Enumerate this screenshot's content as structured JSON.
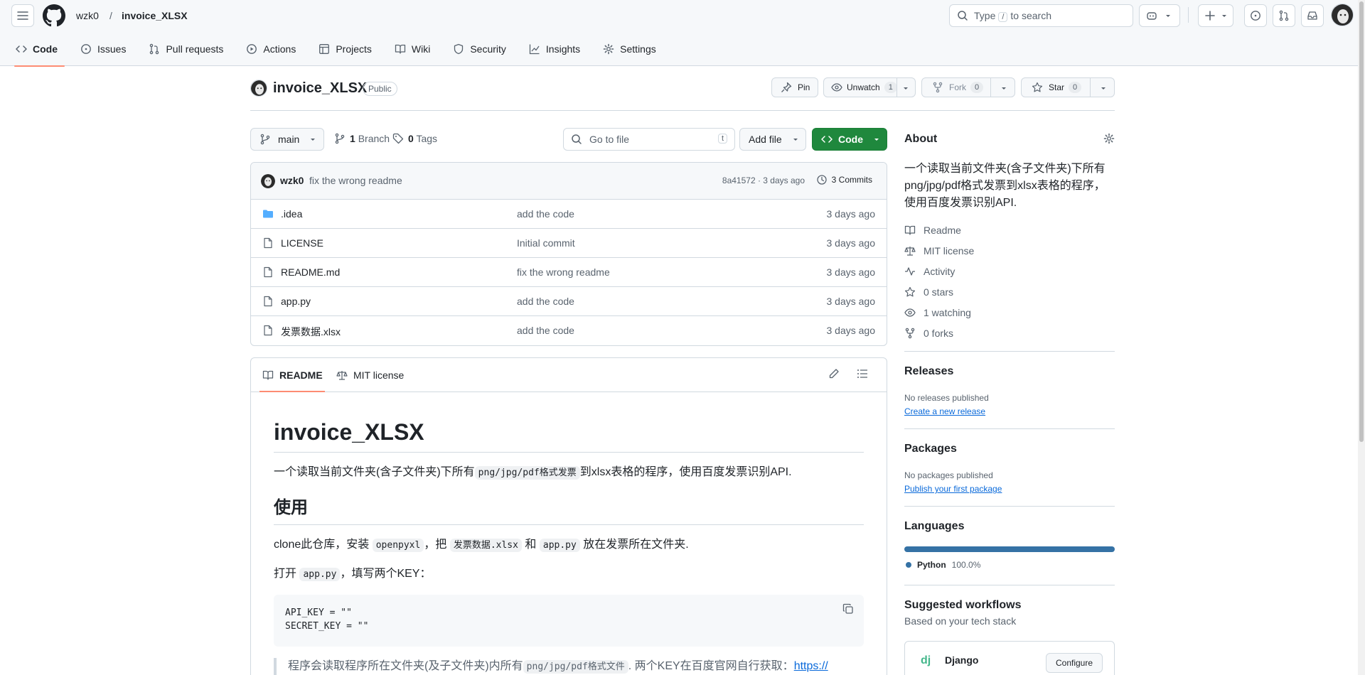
{
  "header": {
    "owner": "wzk0",
    "separator": "/",
    "repo": "invoice_XLSX",
    "search_pre": "Type",
    "search_key": "/",
    "search_post": "to search"
  },
  "tabs": [
    {
      "label": "Code",
      "icon": "code-icon"
    },
    {
      "label": "Issues",
      "icon": "issue-opened-icon"
    },
    {
      "label": "Pull requests",
      "icon": "git-pull-request-icon"
    },
    {
      "label": "Actions",
      "icon": "play-icon"
    },
    {
      "label": "Projects",
      "icon": "table-icon"
    },
    {
      "label": "Wiki",
      "icon": "book-icon"
    },
    {
      "label": "Security",
      "icon": "shield-icon"
    },
    {
      "label": "Insights",
      "icon": "graph-icon"
    },
    {
      "label": "Settings",
      "icon": "gear-icon"
    }
  ],
  "repo": {
    "name": "invoice_XLSX",
    "visibility": "Public",
    "pin": "Pin",
    "unwatch": "Unwatch",
    "watch_count": "1",
    "fork": "Fork",
    "fork_count": "0",
    "star": "Star",
    "star_count": "0"
  },
  "toolbar": {
    "branch": "main",
    "branch_count": "1",
    "branch_label": "Branch",
    "tag_count": "0",
    "tag_label": "Tags",
    "goto_placeholder": "Go to file",
    "goto_key": "t",
    "add_file": "Add file",
    "code": "Code"
  },
  "commit": {
    "author": "wzk0",
    "message": "fix the wrong readme",
    "hash_date": "8a41572 · 3 days ago",
    "commits": "3 Commits"
  },
  "files": [
    {
      "name": ".idea",
      "type": "folder",
      "commit": "add the code",
      "date": "3 days ago"
    },
    {
      "name": "LICENSE",
      "type": "file",
      "commit": "Initial commit",
      "date": "3 days ago"
    },
    {
      "name": "README.md",
      "type": "file",
      "commit": "fix the wrong readme",
      "date": "3 days ago"
    },
    {
      "name": "app.py",
      "type": "file",
      "commit": "add the code",
      "date": "3 days ago"
    },
    {
      "name": "发票数据.xlsx",
      "type": "file",
      "commit": "add the code",
      "date": "3 days ago"
    }
  ],
  "readme": {
    "tab_readme": "README",
    "tab_license": "MIT license",
    "h1": "invoice_XLSX",
    "p1_a": "一个读取当前文件夹(含子文件夹)下所有",
    "p1_code": "png/jpg/pdf格式发票",
    "p1_b": "到xlsx表格的程序，使用百度发票识别API.",
    "h2": "使用",
    "p2_a": "clone此仓库，安装",
    "p2_code1": "openpyxl",
    "p2_b": "，把",
    "p2_code2": "发票数据.xlsx",
    "p2_c": "和",
    "p2_code3": "app.py",
    "p2_d": "放在发票所在文件夹.",
    "p3_a": "打开",
    "p3_code": "app.py",
    "p3_b": "，填写两个KEY：",
    "code_line1": "API_KEY = \"\"",
    "code_line2": "SECRET_KEY = \"\"",
    "quote_a": "程序会读取程序所在文件夹(及子文件夹)内所有",
    "quote_code": "png/jpg/pdf格式文件",
    "quote_b": ". 两个KEY在百度官网自行获取：",
    "quote_link": "https://"
  },
  "about": {
    "title": "About",
    "description": "一个读取当前文件夹(含子文件夹)下所有png/jpg/pdf格式发票到xlsx表格的程序，使用百度发票识别API.",
    "items": [
      {
        "label": "Readme",
        "icon": "book-icon"
      },
      {
        "label": "MIT license",
        "icon": "law-icon"
      },
      {
        "label": "Activity",
        "icon": "pulse-icon"
      },
      {
        "label": "0 stars",
        "icon": "star-icon"
      },
      {
        "label": "1 watching",
        "icon": "eye-icon"
      },
      {
        "label": "0 forks",
        "icon": "fork-icon"
      }
    ]
  },
  "releases": {
    "title": "Releases",
    "empty": "No releases published",
    "link": "Create a new release"
  },
  "packages": {
    "title": "Packages",
    "empty": "No packages published",
    "link": "Publish your first package"
  },
  "languages": {
    "title": "Languages",
    "name": "Python",
    "percent": "100.0%",
    "share": 1.0,
    "color": "#3572A5"
  },
  "workflows": {
    "title": "Suggested workflows",
    "subtitle": "Based on your tech stack",
    "name": "Django",
    "logo": "dj",
    "button": "Configure"
  }
}
